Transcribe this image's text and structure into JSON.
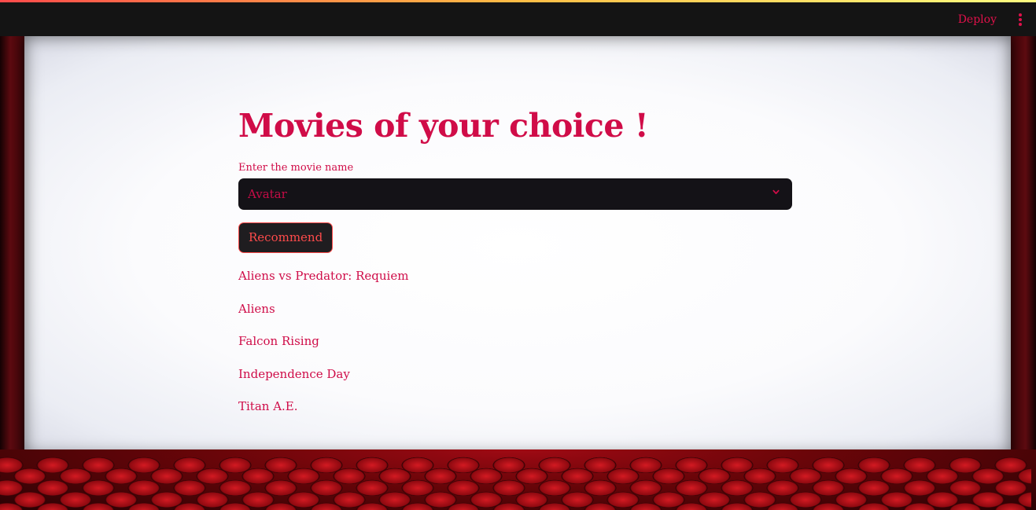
{
  "header": {
    "deploy_label": "Deploy",
    "menu_icon": "kebab-menu-icon"
  },
  "main": {
    "title": "Movies of your choice !",
    "select_label": "Enter the movie name",
    "select_value": "Avatar",
    "button_label": "Recommend",
    "results": [
      "Aliens vs Predator: Requiem",
      "Aliens",
      "Falcon Rising",
      "Independence Day",
      "Titan A.E."
    ]
  },
  "colors": {
    "accent": "#d00c48",
    "button": "#ff4b4b",
    "topbar": "#141414",
    "select_bg": "#141217"
  }
}
